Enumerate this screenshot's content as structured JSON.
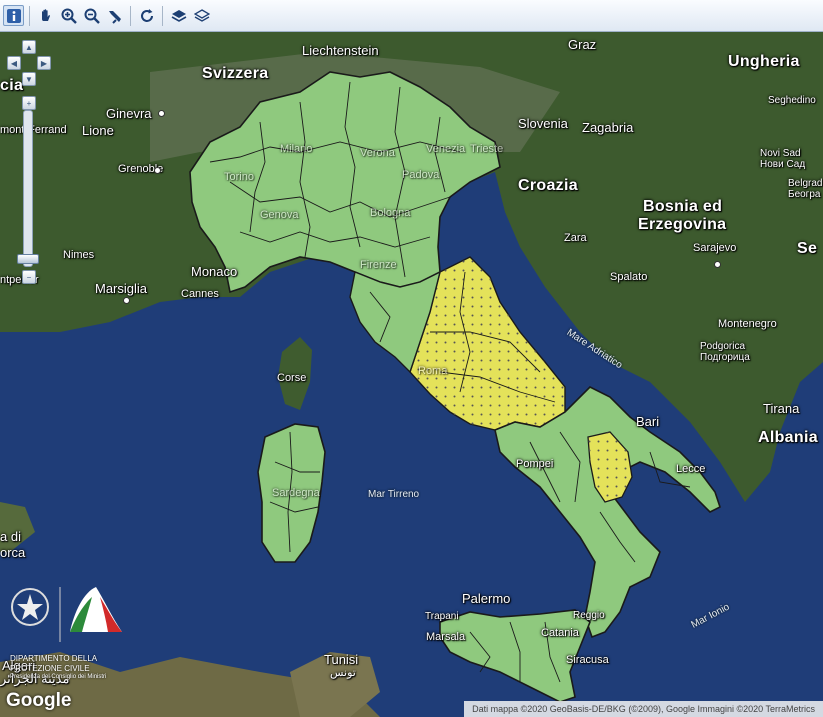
{
  "toolbar": {
    "tools": [
      {
        "name": "info-icon",
        "active": true
      },
      {
        "name": "pan-hand-icon",
        "active": false
      },
      {
        "name": "zoom-in-icon",
        "active": false
      },
      {
        "name": "zoom-out-icon",
        "active": false
      },
      {
        "name": "measure-icon",
        "active": false
      },
      {
        "name": "refresh-icon",
        "active": false
      },
      {
        "name": "layers-icon",
        "active": false
      },
      {
        "name": "layers-outline-icon",
        "active": false
      }
    ]
  },
  "map": {
    "labels": {
      "svizzera": "Svizzera",
      "liechtenstein": "Liechtenstein",
      "graz": "Graz",
      "ungheria": "Ungheria",
      "ginevra": "Ginevra",
      "lione": "Lione",
      "mont_ferrand": "mont-Ferrand",
      "grenoble": "Grenoble",
      "slovenia": "Slovenia",
      "zagabria": "Zagabria",
      "seghedino": "Seghedino",
      "novi_sad": "Novi Sad",
      "novi_sad_cyr": "Нови Сад",
      "belgrado": "Belgrad",
      "beograd_cyr": "Београ",
      "croazia": "Croazia",
      "bosnia": "Bosnia ed",
      "erzegovina": "Erzegovina",
      "zara": "Zara",
      "sarajevo": "Sarajevo",
      "se": "Se",
      "nimes": "Nimes",
      "montpellier": "ntpellier",
      "monaco": "Monaco",
      "marsiglia": "Marsiglia",
      "cannes": "Cannes",
      "spalato": "Spalato",
      "mare_adriatico": "Mare Adriatico",
      "montenegro": "Montenegro",
      "podgorica": "Podgorica",
      "podgorica_cyr": "Подгорица",
      "corse": "Corse",
      "roma": "Roma",
      "bari": "Bari",
      "tirana": "Tirana",
      "albania": "Albania",
      "pompei": "Pompei",
      "lecce": "Lecce",
      "mar_tirreno": "Mar Tirreno",
      "sardegna": "Sardegna",
      "mare_ionio": "Mar Ionio",
      "palermo": "Palermo",
      "trapani": "Trapani",
      "marsala": "Marsala",
      "catania": "Catania",
      "siracusa": "Siracusa",
      "reggio": "Reggio",
      "tunisi": "Tunisi",
      "tunisi_ar": "تونس",
      "algeri": "Algeri",
      "algeri_ar": "مدينة الجزائر",
      "corca": "orca",
      "a_di": "a di",
      "cia": "cia",
      "milano": "Milano",
      "torino": "Torino",
      "bologna": "Bologna",
      "padova": "Padova",
      "venezia": "Venezia",
      "verona": "Verona",
      "genova": "Genova",
      "firenze": "Firenze",
      "trieste": "Trieste"
    },
    "colors": {
      "sea": "#1f3d78",
      "land_dark": "#3c5a2d",
      "region_green": "#8fc97e",
      "region_yellow": "#e4e25a",
      "border": "#1a1a1a"
    },
    "attribution": "Dati mappa ©2020 GeoBasis-DE/BKG (©2009), Google Immagini ©2020 TerraMetrics",
    "google": "Google",
    "logo": {
      "line1": "DIPARTIMENTO DELLA",
      "line2": "PROTEZIONE CIVILE",
      "line3": "Presidenza del Consiglio dei Ministri"
    }
  }
}
